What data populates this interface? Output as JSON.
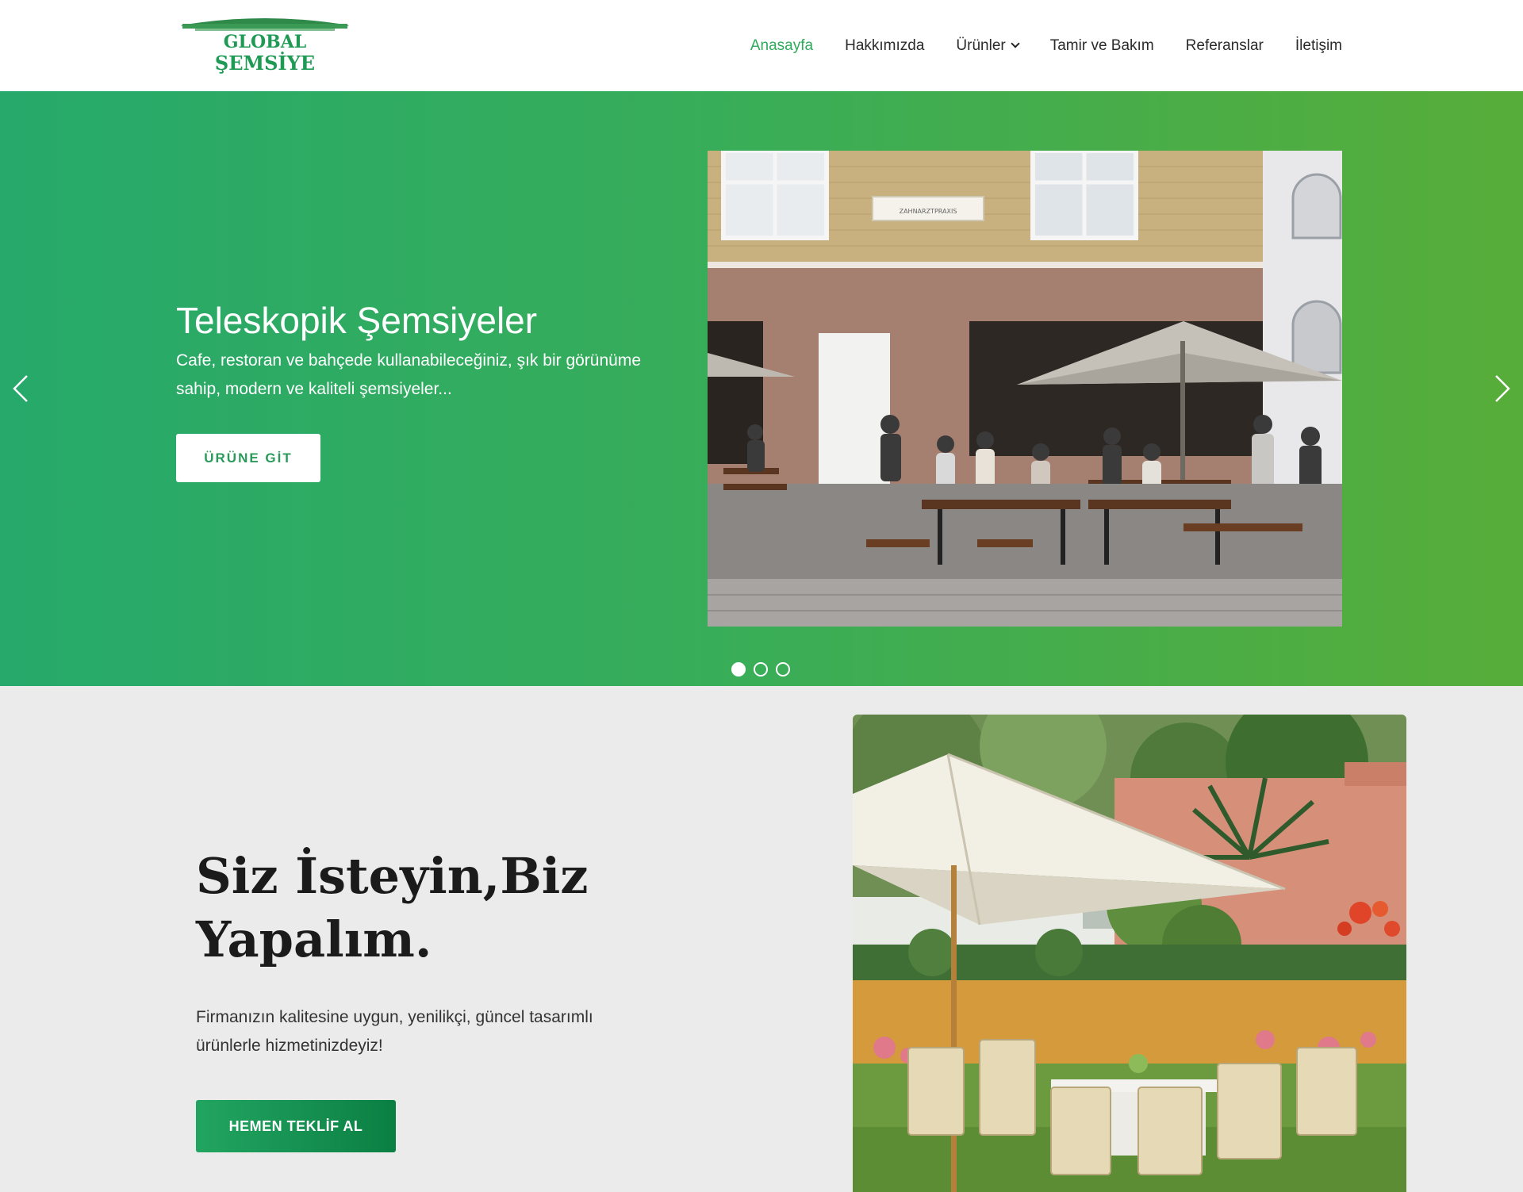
{
  "header": {
    "logo_text_line1": "GLOBAL",
    "logo_text_line2": "ŞEMSİYE",
    "nav": [
      {
        "label": "Anasayfa",
        "active": true
      },
      {
        "label": "Hakkımızda",
        "active": false
      },
      {
        "label": "Ürünler",
        "active": false,
        "has_dropdown": true
      },
      {
        "label": "Tamir ve Bakım",
        "active": false
      },
      {
        "label": "Referanslar",
        "active": false
      },
      {
        "label": "İletişim",
        "active": false
      }
    ]
  },
  "hero": {
    "title": "Teleskopik Şemsiyeler",
    "subtitle": "Cafe, restoran ve bahçede kullanabileceğiniz, şık bir görünüme sahip, modern ve kaliteli şemsiyeler...",
    "button_label": "ÜRÜNE GİT",
    "sign_text": "ZAHNARZTPRAXIS",
    "slide_count": 3,
    "active_slide": 1
  },
  "intro": {
    "title": "Siz İsteyin,Biz Yapalım.",
    "text": "Firmanızın kalitesine uygun, yenilikçi, güncel tasarımlı ürünlerle hizmetinizdeyiz!",
    "button_label": "HEMEN TEKLİF AL"
  },
  "colors": {
    "accent_green": "#2faa5b",
    "hero_gradient_start": "#26a96b",
    "hero_gradient_end": "#57ad39",
    "button_gradient_start": "#22a561",
    "button_gradient_end": "#0b7f43",
    "section_bg": "#ebebeb"
  }
}
